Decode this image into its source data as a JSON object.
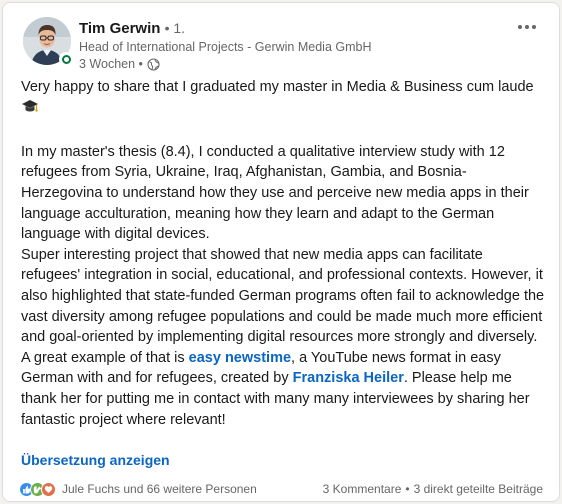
{
  "post": {
    "author": {
      "name": "Tim Gerwin",
      "degree": "• 1.",
      "headline": "Head of International Projects - Gerwin Media GmbH",
      "time": "3 Wochen •"
    },
    "body": {
      "line1": "Very happy to share that I graduated my master in Media & Business cum laude",
      "para2": "In my master's thesis (8.4), I conducted a qualitative interview study with 12 refugees from Syria, Ukraine, Iraq, Afghanistan, Gambia, and Bosnia-Herzegovina to understand how they use and perceive new media apps in their language acculturation, meaning how they learn and adapt to the German language with digital devices.",
      "para3": "Super interesting project that showed that new media apps can facilitate refugees' integration in social, educational, and professional contexts. However, it also highlighted that state-funded German programs often fail to acknowledge the vast diversity among refugee populations and could be made much more efficient and goal-oriented by implementing digital resources more strongly and diversely.",
      "para4_a": "A great example of that is ",
      "link1": "easy newstime",
      "para4_b": ", a YouTube news format in easy German with and for refugees, created by ",
      "link2": "Franziska Heiler",
      "para4_c": ". Please help me thank her for putting me in contact with many many interviewees by sharing her fantastic project where relevant!"
    },
    "translate_label": "Übersetzung anzeigen",
    "social": {
      "reactors": "Jule Fuchs und 66 weitere Personen",
      "comments": "3 Kommentare",
      "separator": "•",
      "reposts": "3 direkt geteilte Beiträge"
    },
    "icons": {
      "more": "more-horizontal-icon",
      "globe": "globe-icon",
      "graduation": "graduation-cap-emoji",
      "reactions": [
        "like-icon",
        "celebrate-icon",
        "support-icon"
      ]
    },
    "colors": {
      "link": "#0a66c2",
      "online": "#057642",
      "like": "#378fe9",
      "celebrate": "#6dae4f",
      "support": "#df704d"
    }
  }
}
